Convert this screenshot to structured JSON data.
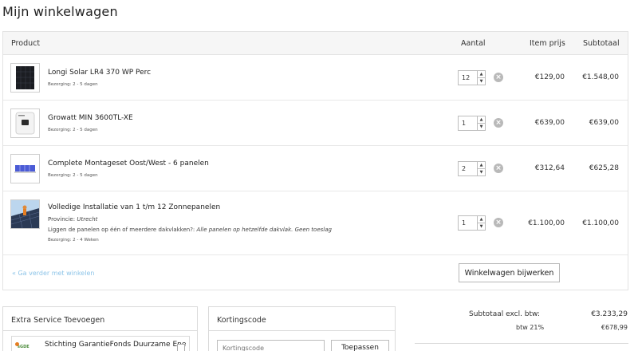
{
  "page": {
    "title": "Mijn winkelwagen"
  },
  "table": {
    "headers": {
      "product": "Product",
      "quantity": "Aantal",
      "item_price": "Item prijs",
      "subtotal": "Subtotaal"
    }
  },
  "items": [
    {
      "name": "Longi Solar LR4 370 WP Perc",
      "delivery": "Bezorging: 2 - 5 dagen",
      "quantity": "12",
      "price": "€129,00",
      "subtotal": "€1.548,00",
      "thumbnail": "solar-panel"
    },
    {
      "name": "Growatt MIN 3600TL-XE",
      "delivery": "Bezorging: 2 - 5 dagen",
      "quantity": "1",
      "price": "€639,00",
      "subtotal": "€639,00",
      "thumbnail": "inverter"
    },
    {
      "name": "Complete Montageset Oost/West - 6 panelen",
      "delivery": "Bezorging: 2 - 5 dagen",
      "quantity": "2",
      "price": "€312,64",
      "subtotal": "€625,28",
      "thumbnail": "mounting-set"
    },
    {
      "name": "Volledige Installatie van 1 t/m 12 Zonnepanelen",
      "province_label": "Provincie:",
      "province_value": "Utrecht",
      "question": "Liggen de panelen op één of meerdere dakvlakken?:",
      "answer": "Alle panelen op hetzelfde dakvlak. Geen toeslag",
      "delivery": "Bezorging: 2 - 4 Weken",
      "quantity": "1",
      "price": "€1.100,00",
      "subtotal": "€1.100,00",
      "thumbnail": "installation-photo"
    }
  ],
  "actions": {
    "continue_shopping": "« Ga verder met winkelen",
    "update_cart": "Winkelwagen bijwerken"
  },
  "extra_service": {
    "title": "Extra Service Toevoegen",
    "option_label": "Stichting GarantieFonds Duurzame Ene",
    "logo_text": "sGDE"
  },
  "discount": {
    "title": "Kortingscode",
    "placeholder": "Kortingscode",
    "apply_label": "Toepassen"
  },
  "totals": {
    "subtotal_label": "Subtotaal excl. btw:",
    "subtotal_value": "€3.233,29",
    "vat_label": "btw 21%",
    "vat_value": "€678,99"
  },
  "colors": {
    "link": "#8cc4e8",
    "header_bg": "#f6f6f6",
    "border": "#e3e3e3",
    "remove_icon": "#b9b9b9"
  }
}
